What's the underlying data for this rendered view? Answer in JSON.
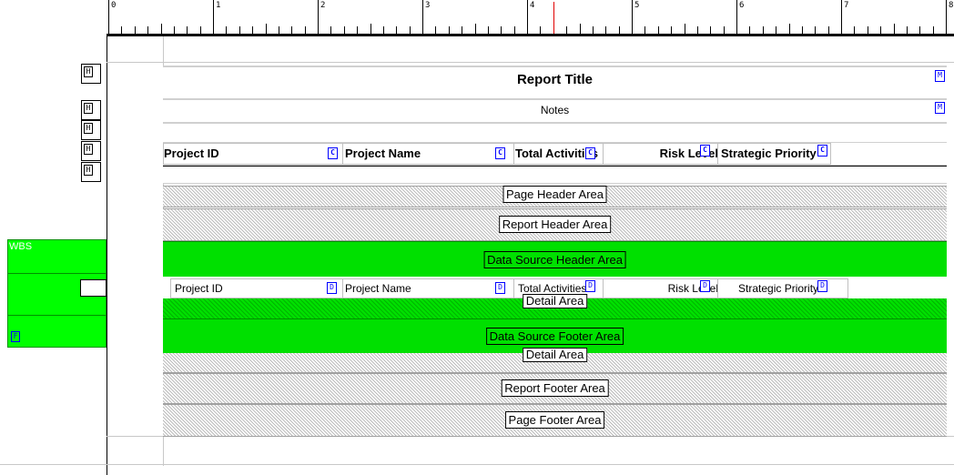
{
  "ruler": {
    "numbers": [
      "0",
      "1",
      "2",
      "3",
      "4",
      "5",
      "6",
      "7",
      "8"
    ]
  },
  "left_panel": {
    "group_label": "WBS",
    "footer_marker": "F",
    "header_markers": [
      "H",
      "H",
      "H",
      "H",
      "H"
    ]
  },
  "report": {
    "title": "Report Title",
    "notes": "Notes",
    "title_marker": "M",
    "notes_marker": "M",
    "column_headers": [
      {
        "label": "Project ID",
        "marker": "C"
      },
      {
        "label": "Project Name",
        "marker": "C"
      },
      {
        "label": "Total Activities",
        "marker": "C"
      },
      {
        "label": "Risk Level",
        "marker": "C"
      },
      {
        "label": "Strategic Priority",
        "marker": "C"
      }
    ],
    "detail_fields": [
      {
        "label": "Project ID",
        "marker": "D"
      },
      {
        "label": "Project Name",
        "marker": "D"
      },
      {
        "label": "Total Activities",
        "marker": "D"
      },
      {
        "label": "Risk Level",
        "marker": "D"
      },
      {
        "label": "Strategic Priority",
        "marker": "D"
      }
    ]
  },
  "areas": {
    "page_header": "Page Header Area",
    "report_header": "Report Header Area",
    "data_source_header": "Data Source Header Area",
    "detail": "Detail Area",
    "data_source_footer": "Data Source Footer Area",
    "detail_lower": "Detail Area",
    "report_footer": "Report Footer Area",
    "page_footer": "Page Footer Area"
  },
  "colors": {
    "group_band": "#00e000",
    "cursor": "#e00000",
    "marker": "#0000ff"
  }
}
